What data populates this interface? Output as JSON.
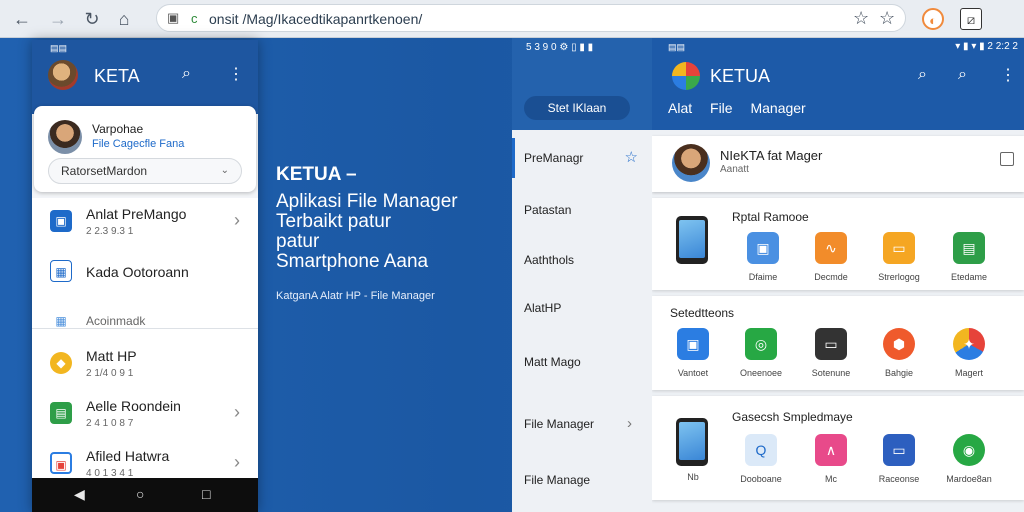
{
  "browser": {
    "back_icon": "arrow-left-icon",
    "url_secure": "c",
    "url_text": "onsit /Mag/Ikacedtikapanrtkenoen/",
    "extensions": [
      "shield-icon",
      "puzzle-icon"
    ]
  },
  "phone1": {
    "status": "▤▤",
    "title": "KETA",
    "card": {
      "name": "Varpohae",
      "subtitle": "File Cagecfle Fana",
      "input_value": "RatorsetMardon"
    },
    "items": [
      {
        "label": "Anlat PreMango",
        "sub": "2 2.3 9.3 1"
      },
      {
        "label": "Kada Ootoroann",
        "sub": ""
      },
      {
        "label": "Acoinmadk",
        "sub": ""
      },
      {
        "label": "Matt HP",
        "sub": "2 1/4 0 9 1"
      },
      {
        "label": "Aelle Roondein",
        "sub": "2 4 1 0 8 7"
      },
      {
        "label": "Afiled Hatwra",
        "sub": "4 0 1 3 4 1"
      }
    ]
  },
  "hero": {
    "title": "KETUA –",
    "lines": [
      "Aplikasi File Manager",
      "Terbaikt patur",
      "patur",
      "Smartphone Aana"
    ],
    "caption": "KatganA Alatr HP - File Manager"
  },
  "drawer": {
    "status": "5 3 9 0  ⚙  ▯ ▮ ▮",
    "pill": "Stet IKlaan",
    "items": [
      {
        "label": "PreManagr"
      },
      {
        "label": "Patastan"
      },
      {
        "label": "Aaththols"
      },
      {
        "label": "AlatHP"
      },
      {
        "label": "Matt Mago"
      },
      {
        "label": "File Manager"
      },
      {
        "label": "File Manage"
      }
    ]
  },
  "phone2": {
    "status_left": "▤▤",
    "status_right": "▾ ▮ ▾ ▮ 2 2:2 2",
    "title": "KETUA",
    "tabs": [
      "Alat",
      "File",
      "Manager"
    ],
    "user": {
      "name": "NIeKTA fat Mager",
      "sub": "Aanatt"
    },
    "sections": [
      {
        "title": "Rptal Ramooe",
        "tiles": [
          "Dfaime",
          "Decmde",
          "Strerlogog",
          "Etedame"
        ]
      },
      {
        "title": "Setedtteons",
        "tiles": [
          "Vantoet",
          "Oneenoee",
          "Sotenune",
          "Bahgie",
          "Magert"
        ]
      },
      {
        "title": "Gasecsh Smpledmaye",
        "tiles": [
          "Nb",
          "Dooboane",
          "Mc",
          "Raceonse",
          "Mardoe8an"
        ]
      }
    ]
  },
  "colors": {
    "accent": "#1e56a0",
    "link": "#1e6ac9"
  }
}
